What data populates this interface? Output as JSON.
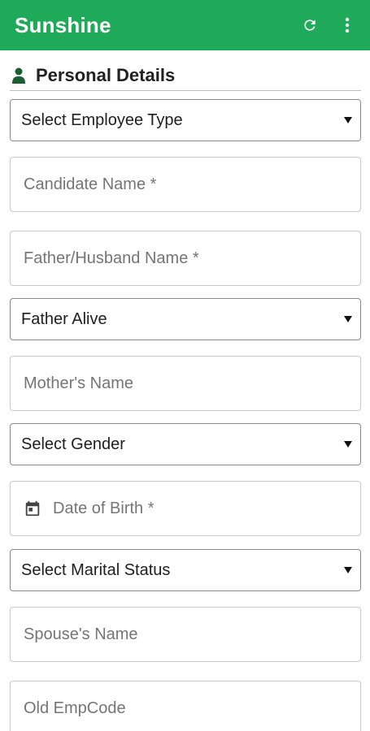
{
  "colors": {
    "appbar_bg": "#1faa5a",
    "icon_dark": "#1c5e32"
  },
  "appbar": {
    "title": "Sunshine",
    "refresh_icon": "refresh-icon",
    "more_icon": "more-vert-icon"
  },
  "section": {
    "icon": "person-icon",
    "title": "Personal Details"
  },
  "form": {
    "employee_type": {
      "value": "Select Employee Type"
    },
    "candidate_name": {
      "placeholder": "Candidate Name *"
    },
    "father_husband_name": {
      "placeholder": "Father/Husband Name *"
    },
    "father_alive": {
      "value": "Father Alive"
    },
    "mother_name": {
      "placeholder": "Mother's Name"
    },
    "gender": {
      "value": "Select Gender"
    },
    "date_of_birth": {
      "placeholder": "Date of Birth *",
      "icon": "calendar-icon"
    },
    "marital_status": {
      "value": "Select Marital Status"
    },
    "spouse_name": {
      "placeholder": "Spouse's Name"
    },
    "old_emp_code": {
      "placeholder": "Old EmpCode"
    }
  }
}
